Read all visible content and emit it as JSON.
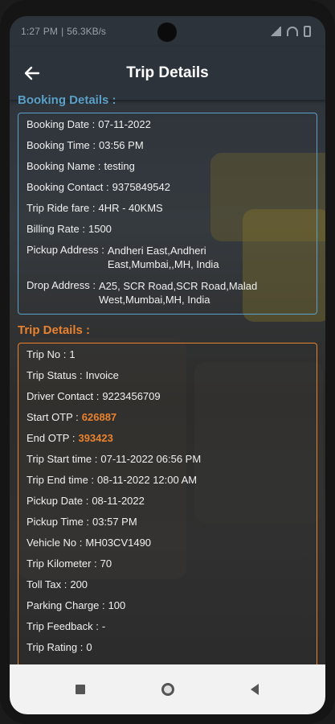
{
  "status_bar": {
    "time": "1:27 PM",
    "speed": "56.3KB/s"
  },
  "app_bar": {
    "title": "Trip Details"
  },
  "booking": {
    "heading": "Booking Details :",
    "rows": [
      {
        "label": "Booking Date :",
        "value": "07-11-2022"
      },
      {
        "label": "Booking Time :",
        "value": "03:56 PM"
      },
      {
        "label": "Booking Name :",
        "value": "testing"
      },
      {
        "label": "Booking Contact :",
        "value": "9375849542"
      },
      {
        "label": "Trip Ride fare :",
        "value": "4HR - 40KMS"
      },
      {
        "label": "Billing Rate :",
        "value": "1500"
      },
      {
        "label": "Pickup Address :",
        "value": "Andheri East,Andheri East,Mumbai,,MH, India"
      },
      {
        "label": "Drop Address :",
        "value": "A25, SCR Road,SCR Road,Malad West,Mumbai,MH, India"
      }
    ]
  },
  "trip": {
    "heading": "Trip Details :",
    "rows": [
      {
        "label": "Trip No :",
        "value": "1"
      },
      {
        "label": "Trip Status :",
        "value": "Invoice"
      },
      {
        "label": "Driver Contact :",
        "value": "9223456709"
      },
      {
        "label": "Start OTP :",
        "value": "626887"
      },
      {
        "label": "End OTP :",
        "value": "393423"
      },
      {
        "label": "Trip Start time :",
        "value": "07-11-2022 06:56 PM"
      },
      {
        "label": "Trip End time :",
        "value": "08-11-2022 12:00 AM"
      },
      {
        "label": "Pickup Date :",
        "value": "08-11-2022"
      },
      {
        "label": "Pickup Time :",
        "value": "03:57 PM"
      },
      {
        "label": "Vehicle No :",
        "value": "MH03CV1490"
      },
      {
        "label": "Trip Kilometer :",
        "value": "70"
      },
      {
        "label": "Toll Tax :",
        "value": "200"
      },
      {
        "label": "Parking Charge :",
        "value": "100"
      },
      {
        "label": "Trip Feedback :",
        "value": "-"
      },
      {
        "label": "Trip Rating :",
        "value": "0"
      }
    ]
  },
  "colors": {
    "booking_accent": "#5aa0c8",
    "trip_accent": "#e8822f",
    "appbar": "#2c333a"
  },
  "icons": {
    "back": "arrow-left-icon",
    "nav_recent": "square-icon",
    "nav_home": "circle-icon",
    "nav_back": "triangle-icon"
  }
}
